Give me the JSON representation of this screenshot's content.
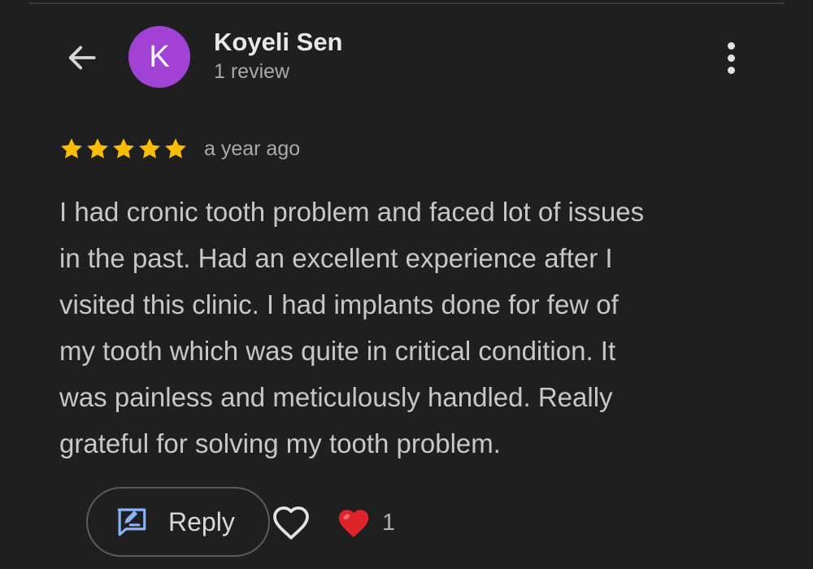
{
  "reviewer": {
    "avatar_letter": "K",
    "avatar_color": "#a142d4",
    "name": "Koyeli Sen",
    "review_count": "1 review"
  },
  "review": {
    "rating": 5,
    "max_rating": 5,
    "star_color": "#fbbc04",
    "date": "a year ago",
    "text_lines": [
      "I had cronic tooth problem and faced lot of issues",
      "in the past. Had an excellent experience after I",
      "visited this clinic. I had implants done for few of",
      "my tooth which was quite in critical condition. It",
      "was painless and meticulously handled. Really",
      "grateful for solving my tooth problem."
    ]
  },
  "actions": {
    "reply_label": "Reply",
    "reply_icon": "rate-review-icon",
    "like_icon": "heart-outline-icon",
    "reaction_icon": "red-heart-icon",
    "reaction_count": "1"
  },
  "icons": {
    "back": "arrow-back-icon",
    "more": "more-vertical-icon",
    "star": "star-icon"
  },
  "colors": {
    "background": "#1f1f1f",
    "accent_blue": "#8ab4f8",
    "heart_red": "#e0242c"
  }
}
